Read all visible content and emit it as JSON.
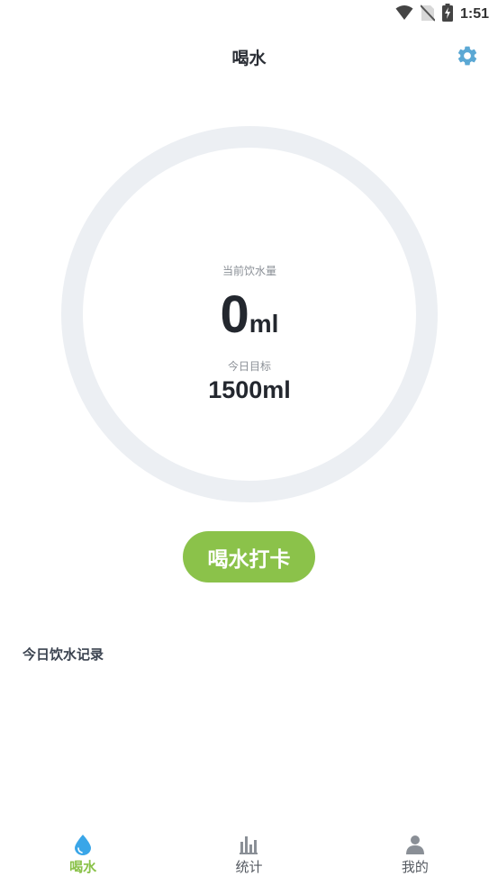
{
  "status_bar": {
    "time": "1:51",
    "icons": [
      "wifi-icon",
      "no-sim-icon",
      "battery-charging-icon"
    ]
  },
  "header": {
    "title": "喝水",
    "settings_icon": "gear-icon"
  },
  "progress": {
    "current_label": "当前饮水量",
    "current_value": "0",
    "current_unit": "ml",
    "goal_label": "今日目标",
    "goal_value": "1500ml",
    "fraction": 0
  },
  "actions": {
    "checkin_label": "喝水打卡"
  },
  "records": {
    "title": "今日饮水记录",
    "items": []
  },
  "bottom_nav": {
    "items": [
      {
        "label": "喝水",
        "icon": "water-drop-icon",
        "active": true
      },
      {
        "label": "统计",
        "icon": "bar-chart-icon",
        "active": false
      },
      {
        "label": "我的",
        "icon": "person-icon",
        "active": false
      }
    ]
  },
  "colors": {
    "accent": "#8bc24a",
    "ring_track": "#eceff3",
    "drop_blue": "#3aa6e8",
    "settings_blue": "#5ba8d4"
  }
}
